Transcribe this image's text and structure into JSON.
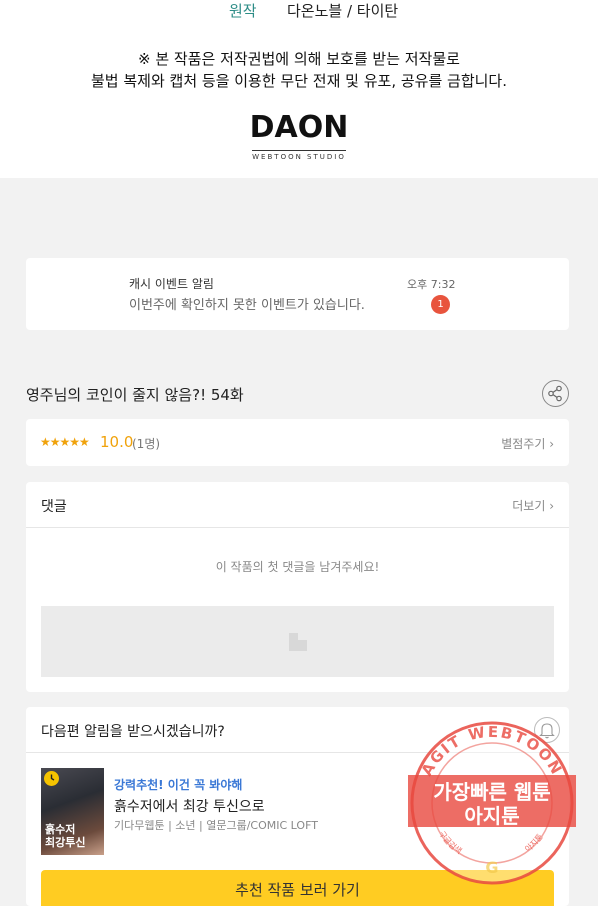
{
  "header": {
    "origin_label": "원작",
    "origin_value": "다온노블 / 타이탄",
    "notice_line1": "※ 본 작품은 저작권법에 의해 보호를 받는 저작물로",
    "notice_line2": "불법 복제와 캡처 등을 이용한 무단 전재 및 유포, 공유를 금합니다.",
    "logo_main": "DAON",
    "logo_sub": "WEBTOON STUDIO"
  },
  "event": {
    "title": "캐시 이벤트 알림",
    "message": "이번주에 확인하지 못한 이벤트가 있습니다.",
    "time": "오후 7:32",
    "badge_count": "1",
    "badge_color": "#e8543d"
  },
  "episode": {
    "title": "영주님의 코인이 줄지 않음?! 54화",
    "share_icon": "share-icon"
  },
  "rating": {
    "stars": "★★★★★",
    "score": "10.0",
    "count": "(1명)",
    "rate_label": "별점주기 ›",
    "accent_color": "#f0a20b"
  },
  "comments": {
    "label": "댓글",
    "more_label": "더보기 ›",
    "empty_text": "이 작품의 첫 댓글을 남겨주세요!"
  },
  "next": {
    "prompt": "다음편 알림을 받으시겠습니까?",
    "bell_icon": "bell-icon",
    "thumb_title_line1": "흙수저",
    "thumb_title_line2": "최강투신",
    "rec_tag": "강력추천! 이건 꼭 봐야해",
    "rec_title": "흙수저에서 최강 투신으로",
    "rec_meta": "기다무웹툰 | 소년 | 열문그룹/COMIC LOFT",
    "button_label": "추천 작품 보러 가기",
    "button_color": "#ffcc22"
  },
  "watermark": {
    "ring_text": "AGIT WEBTOON",
    "line1": "가장빠른 웹툰",
    "line2": "아지툰",
    "bottom_left": "구글검색",
    "bottom_right": "아지툰",
    "color": "#e8493f"
  }
}
